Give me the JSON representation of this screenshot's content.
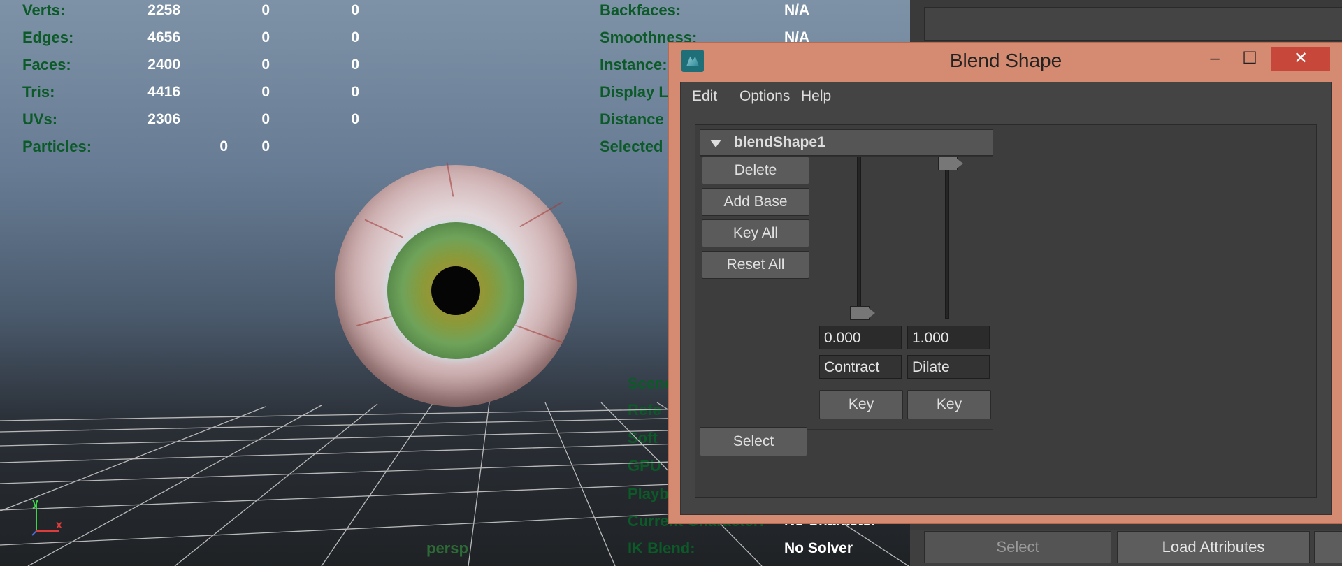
{
  "hud": {
    "rows": [
      {
        "label": "Verts:",
        "v1": "2258",
        "v2": "0",
        "v3": "0"
      },
      {
        "label": "Edges:",
        "v1": "4656",
        "v2": "0",
        "v3": "0"
      },
      {
        "label": "Faces:",
        "v1": "2400",
        "v2": "0",
        "v3": "0"
      },
      {
        "label": "Tris:",
        "v1": "4416",
        "v2": "0",
        "v3": "0"
      },
      {
        "label": "UVs:",
        "v1": "2306",
        "v2": "0",
        "v3": "0"
      },
      {
        "label": "Particles:",
        "v1": "0",
        "v2": "0"
      }
    ],
    "right_rows": [
      {
        "label": "Backfaces:",
        "value": "N/A"
      },
      {
        "label": "Smoothness:",
        "value": "N/A"
      },
      {
        "label": "Instance:"
      },
      {
        "label": "Display L"
      },
      {
        "label": "Distance"
      },
      {
        "label": "Selected"
      }
    ],
    "bottom_rows": [
      {
        "label": "Scene"
      },
      {
        "label": "Refe"
      },
      {
        "label": "Soft"
      },
      {
        "label": "GPU"
      },
      {
        "label": "Playb"
      },
      {
        "label": "Current Character:",
        "value": "No Character"
      },
      {
        "label": "IK Blend:",
        "value": "No Solver"
      }
    ],
    "camera": "persp",
    "axis_y": "y",
    "axis_x": "x"
  },
  "window": {
    "title": "Blend Shape",
    "minimize": "–",
    "maximize": "☐",
    "close": "✕",
    "menus": [
      "Edit",
      "Options",
      "Help"
    ],
    "frame_name": "blendShape1",
    "buttons": [
      "Delete",
      "Add Base",
      "Key All",
      "Reset All"
    ],
    "select_label": "Select",
    "targets": [
      {
        "value": "0.000",
        "name": "Contract",
        "key": "Key",
        "weight": 0
      },
      {
        "value": "1.000",
        "name": "Dilate",
        "key": "Key",
        "weight": 1
      }
    ]
  },
  "attr_editor": {
    "select_label": "Select",
    "load_label": "Load Attributes"
  },
  "colors": {
    "hud_green": "#0b5a28",
    "window_border": "#d58b71",
    "close_red": "#c7483b"
  }
}
